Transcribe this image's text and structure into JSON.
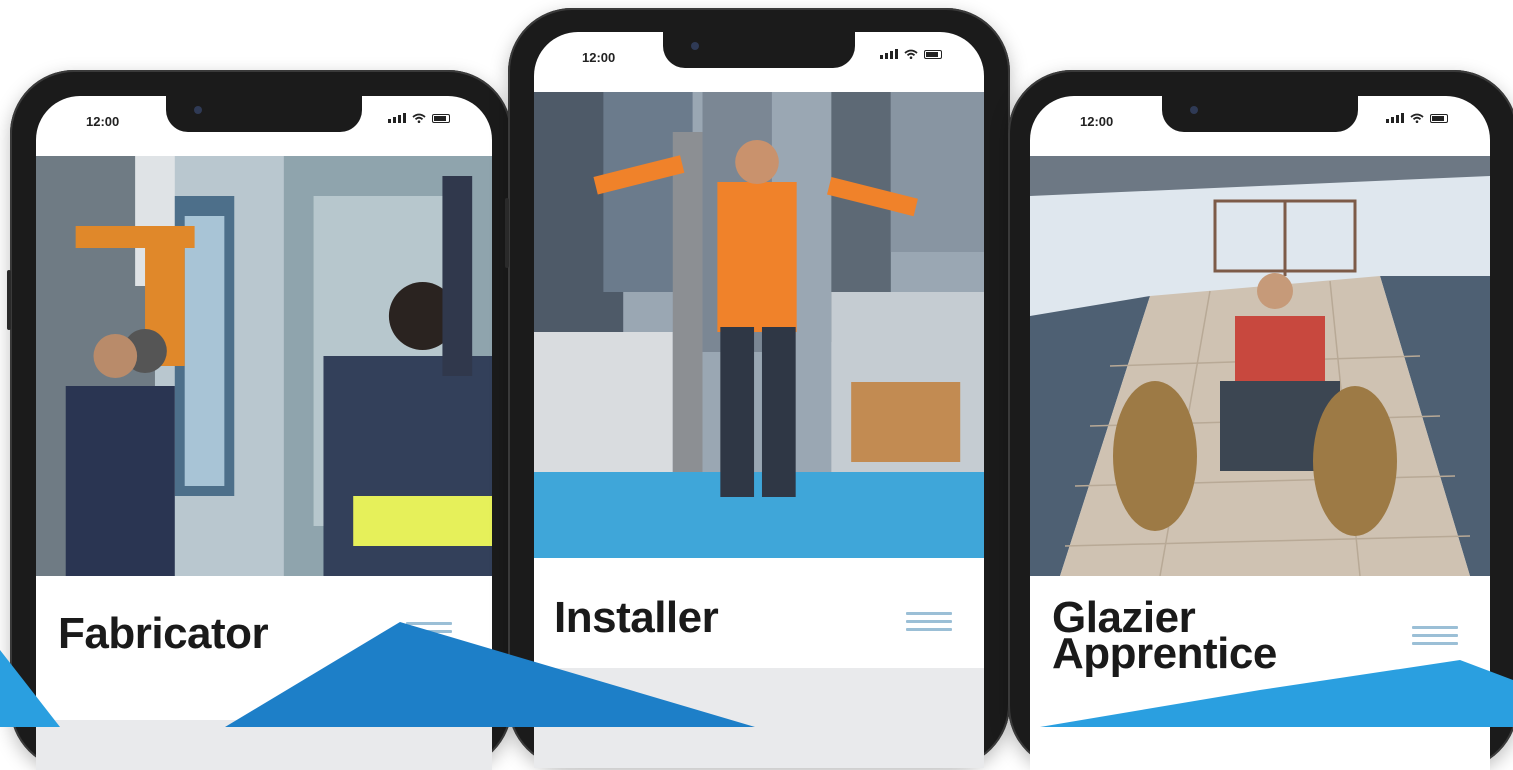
{
  "phones": [
    {
      "time": "12:00",
      "title_line1": "Fabricator",
      "title_line2": ""
    },
    {
      "time": "12:00",
      "title_line1": "Installer",
      "title_line2": ""
    },
    {
      "time": "12:00",
      "title_line1": "Glazier",
      "title_line2": "Apprentice"
    }
  ],
  "icons": [
    "signal-icon",
    "wifi-icon",
    "battery-icon",
    "hamburger-menu-icon"
  ],
  "colors": {
    "accent_blue": "#1d7fc8",
    "light_blue": "#2a9fe0",
    "menu_lines": "#9bbfd6"
  }
}
